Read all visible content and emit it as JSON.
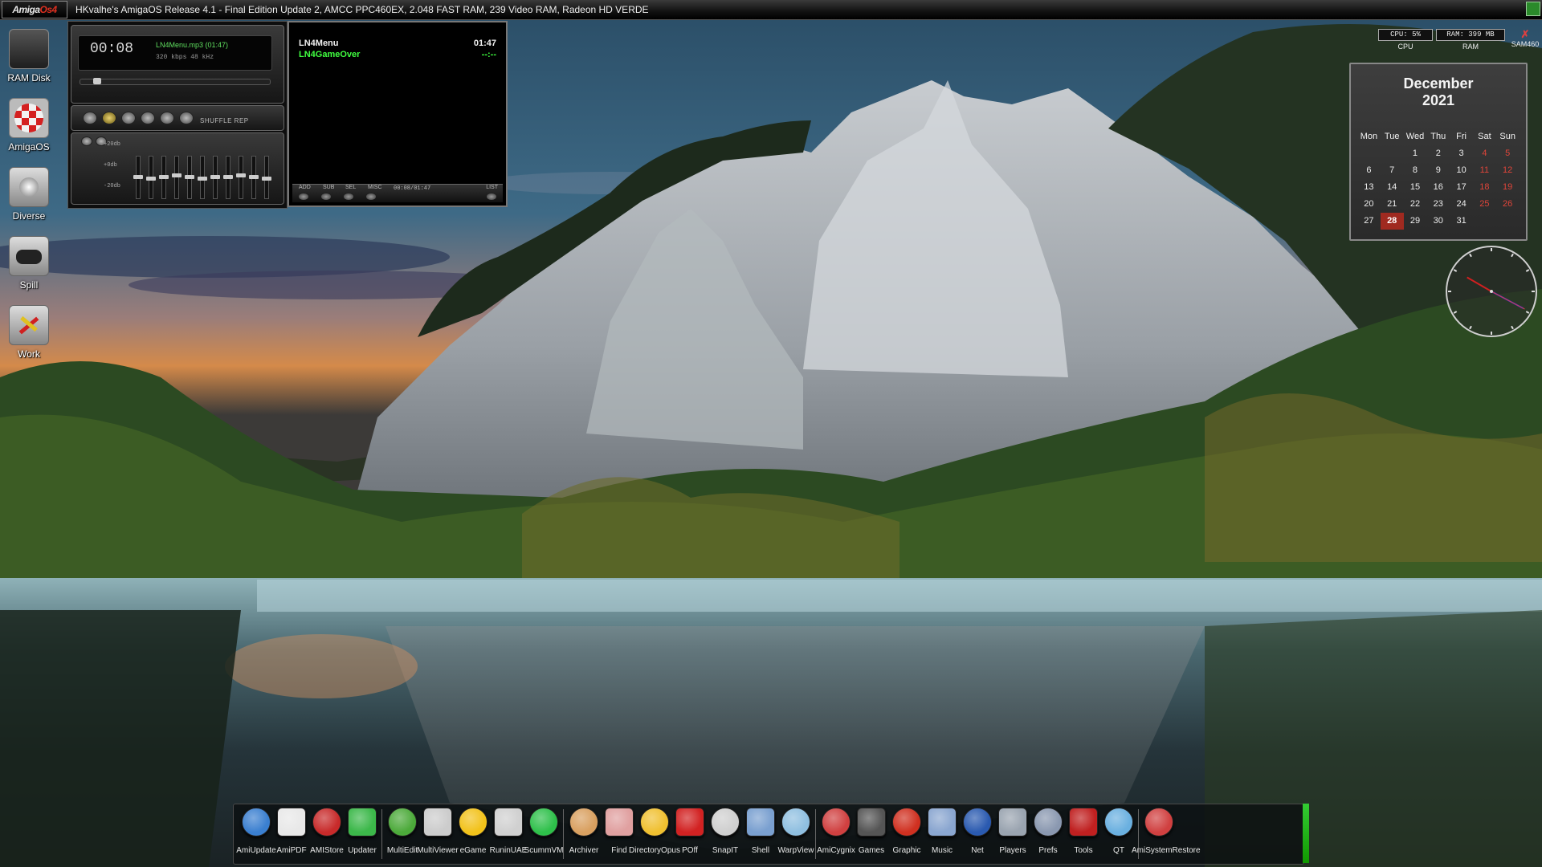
{
  "screen": {
    "logo": {
      "part1": "Amiga",
      "part2": "Os4"
    },
    "title": "HKvalhe's AmigaOS Release 4.1 - Final Edition Update 2, AMCC PPC460EX, 2.048 FAST RAM, 239 Video RAM, Radeon HD VERDE"
  },
  "desktop_icons": [
    {
      "label": "RAM Disk",
      "icon": "ram-disk-icon"
    },
    {
      "label": "AmigaOS",
      "icon": "boing-ball-icon"
    },
    {
      "label": "Diverse",
      "icon": "drive-icon"
    },
    {
      "label": "Spill",
      "icon": "gamepad-icon"
    },
    {
      "label": "Work",
      "icon": "work-drive-icon"
    }
  ],
  "player": {
    "time": "00:08",
    "track": "LN4Menu.mp3 (01:47)",
    "rate": "320 kbps  48 kHz",
    "shuffle_label": "SHUFFLE  REP",
    "eq_labels": [
      "+20db",
      "+0db",
      "-20db"
    ]
  },
  "playlist": {
    "rows": [
      {
        "title": "LN4Menu",
        "time": "01:47"
      },
      {
        "title": "LN4GameOver",
        "time": "--:--"
      }
    ],
    "buttons": [
      "ADD",
      "SUB",
      "SEL",
      "MISC",
      "LIST"
    ],
    "position": "00:08/01:47"
  },
  "monitors": {
    "cpu_value": "CPU: 5%",
    "cpu_name": "CPU",
    "ram_value": "RAM: 399 MB",
    "ram_name": "RAM",
    "sam_label": "SAM460"
  },
  "calendar": {
    "month": "December",
    "year": "2021",
    "weekdays": [
      "Mon",
      "Tue",
      "Wed",
      "Thu",
      "Fri",
      "Sat",
      "Sun"
    ],
    "weeks": [
      [
        "",
        "",
        "1",
        "2",
        "3",
        "4",
        "5"
      ],
      [
        "6",
        "7",
        "8",
        "9",
        "10",
        "11",
        "12"
      ],
      [
        "13",
        "14",
        "15",
        "16",
        "17",
        "18",
        "19"
      ],
      [
        "20",
        "21",
        "22",
        "23",
        "24",
        "25",
        "26"
      ],
      [
        "27",
        "28",
        "29",
        "30",
        "31",
        "",
        ""
      ]
    ],
    "today": "28"
  },
  "clock": {
    "hour_angle": 300,
    "minute_angle": 118,
    "second_angle": 118
  },
  "dock": {
    "groups": [
      [
        {
          "label": "AmiUpdate",
          "icon": "refresh-icon",
          "color": "#3a7fd0"
        },
        {
          "label": "AmiPDF",
          "icon": "pdf-icon",
          "color": "#e8e8e8"
        },
        {
          "label": "AMIStore",
          "icon": "shopping-bag-icon",
          "color": "#c82a2a"
        },
        {
          "label": "Updater",
          "icon": "down-arrow-icon",
          "color": "#3cb84a"
        }
      ],
      [
        {
          "label": "MultiEdit",
          "icon": "pencil-icon",
          "color": "#4caa3a"
        },
        {
          "label": "MultiViewer",
          "icon": "viewer-icon",
          "color": "#cccccc"
        },
        {
          "label": "eGame",
          "icon": "pacman-icon",
          "color": "#f2c21a"
        },
        {
          "label": "RuninUAE",
          "icon": "uae-icon",
          "color": "#d0d0d0"
        },
        {
          "label": "ScummVM",
          "icon": "scummvm-icon",
          "color": "#2ec04a"
        }
      ],
      [
        {
          "label": "Archiver",
          "icon": "archive-icon",
          "color": "#d9a060"
        },
        {
          "label": "Find",
          "icon": "find-icon",
          "color": "#e0a0a0"
        },
        {
          "label": "DirectoryOpus",
          "icon": "directory-opus-icon",
          "color": "#f0c030"
        },
        {
          "label": "POff",
          "icon": "power-icon",
          "color": "#d22222"
        },
        {
          "label": "SnapIT",
          "icon": "camera-icon",
          "color": "#cfcfcf"
        },
        {
          "label": "Shell",
          "icon": "shell-icon",
          "color": "#7aa0d0"
        },
        {
          "label": "WarpView",
          "icon": "eye-icon",
          "color": "#8fbfe0"
        }
      ],
      [
        {
          "label": "AmiCygnix",
          "icon": "amicygnix-icon",
          "color": "#d04040"
        },
        {
          "label": "Games",
          "icon": "games-icon",
          "color": "#555555"
        },
        {
          "label": "Graphic",
          "icon": "graphic-icon",
          "color": "#d03020"
        },
        {
          "label": "Music",
          "icon": "music-icon",
          "color": "#8aa6d0"
        },
        {
          "label": "Net",
          "icon": "globe-icon",
          "color": "#2a5ab0"
        },
        {
          "label": "Players",
          "icon": "speaker-icon",
          "color": "#9aa4b0"
        },
        {
          "label": "Prefs",
          "icon": "prefs-icon",
          "color": "#8a98b0"
        },
        {
          "label": "Tools",
          "icon": "tools-icon",
          "color": "#c02020"
        },
        {
          "label": "QT",
          "icon": "qt-icon",
          "color": "#6ab0e0"
        }
      ],
      [
        {
          "label": "AmiSystemRestore",
          "icon": "system-restore-icon",
          "color": "#d04040"
        }
      ]
    ]
  }
}
